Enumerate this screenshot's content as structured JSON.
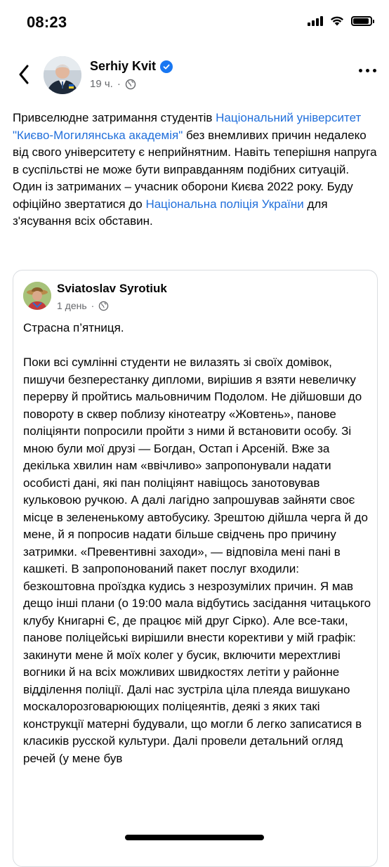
{
  "status_bar": {
    "time": "08:23",
    "battery_level": 0.92,
    "icons": [
      "cellular-signal-icon",
      "wifi-icon",
      "battery-icon"
    ]
  },
  "post": {
    "author": "Serhiy Kvit",
    "verified": true,
    "time": "19 ч.",
    "privacy_icon": "globe-icon",
    "text_parts": [
      {
        "text": "Привселюдне затримання студентів ",
        "link": false
      },
      {
        "text": "Національний університет \"Києво-Могилянська академія\"",
        "link": true
      },
      {
        "text": " без внемливих причин недалеко від свого університету є неприйнятним. Навіть теперішня напруга в суспільстві не може бути виправданням подібних ситуацій. Один із затриманих – учасник оборони Києва 2022 року. Буду офіційно звертатися до ",
        "link": false
      },
      {
        "text": "Національна поліція України",
        "link": true
      },
      {
        "text": " для з'ясування всіх обставин.",
        "link": false
      }
    ]
  },
  "shared_post": {
    "author": "Sviatoslav Syrotiuk",
    "time": "1 день",
    "privacy_icon": "globe-icon",
    "paragraphs": [
      "Страсна п’ятниця.",
      "Поки всі сумлінні студенти не вилазять зі своїх домівок, пишучи безперестанку дипломи, вирішив я взяти невеличку перерву й пройтись мальовничим Подолом. Не дійшовши до повороту в сквер поблизу кінотеатру «Жовтень», панове поліціянти попросили пройти з ними й встановити особу. Зі мною були мої друзі — Богдан, Остап і Арсеній. Вже за декілька хвилин нам «ввічливо» запропонували надати особисті дані, які пан поліціянт навіщось занотовував кульковою ручкою. А далі лагідно запрошував зайняти своє місце в зелененькому автобусику. Зрештою дійшла черга й до мене, й я попросив надати більше свідчень про причину затримки. «Превентивні заходи», — відповіла мені пані в кашкеті. В запропонований пакет послуг входили: безкоштовна проїздка кудись з незрозумілих причин. Я мав дещо інші плани (о 19:00 мала відбутись засідання читацького клубу Книгарні Є, де працює мій друг Сірко). Але все-таки, панове поліцейські вирішили внести корективи у мій графік: закинути мене й моїх колег у бусик, включити мерехтливі вогники й на всіх можливих швидкостях летіти у районне відділення поліції. Далі нас зустріла ціла плеяда вишукано москалорозговарюющих поліцеянтів, деякі з яких такі конструкції матерні будували, що могли б легко записатися в класиків русской культури. Далі провели детальний огляд речей (у мене був"
    ]
  }
}
